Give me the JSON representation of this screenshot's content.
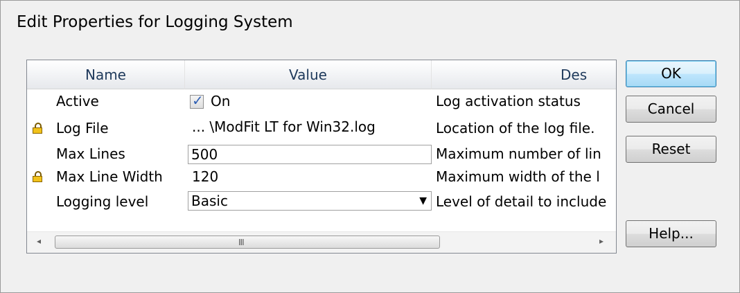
{
  "window": {
    "title": "Edit Properties for Logging System"
  },
  "grid": {
    "columns": {
      "name": "Name",
      "value": "Value",
      "description": "Des"
    },
    "rows": [
      {
        "name": "Active",
        "locked": false,
        "value_type": "checkbox",
        "checked": true,
        "value": "On",
        "description": "Log activation status"
      },
      {
        "name": "Log File",
        "locked": true,
        "value_type": "text",
        "value": "... \\ModFit LT for Win32.log",
        "description": "Location of the log file."
      },
      {
        "name": "Max Lines",
        "locked": false,
        "value_type": "input",
        "value": "500",
        "description": "Maximum number of lin"
      },
      {
        "name": "Max Line Width",
        "locked": true,
        "value_type": "text",
        "value": "120",
        "description": "Maximum width of the l"
      },
      {
        "name": "Logging level",
        "locked": false,
        "value_type": "combo",
        "value": "Basic",
        "description": "Level of detail to include"
      }
    ],
    "scrollbar": {
      "left_arrow": "◂",
      "right_arrow": "▸",
      "grip": "III"
    }
  },
  "buttons": {
    "ok": "OK",
    "cancel": "Cancel",
    "reset": "Reset",
    "help": "Help..."
  },
  "icons": {
    "check_mark": "✓",
    "dropdown_arrow": "▼"
  },
  "colors": {
    "header_text": "#1e395b",
    "lock": "#f1c21b",
    "default_button_border": "#3c7fb1"
  }
}
